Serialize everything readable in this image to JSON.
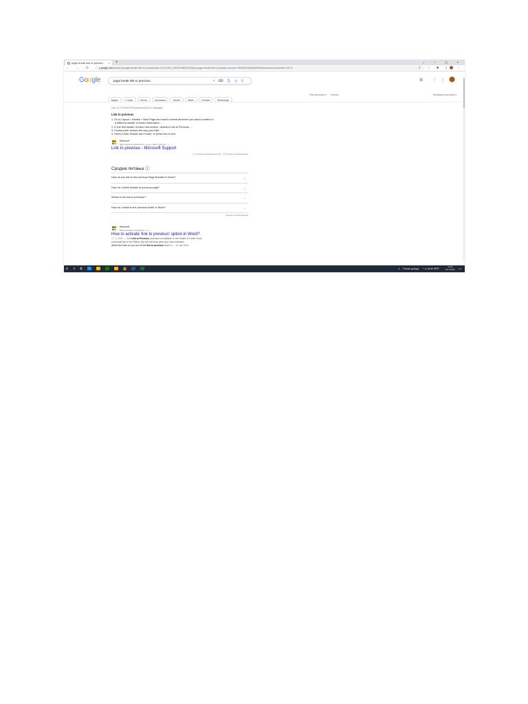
{
  "browser": {
    "tab_title": "page break link to previous - Go",
    "tab_close": "×",
    "new_tab": "+",
    "window_controls": "⌄ – ▢ ×",
    "nav_buttons": "← → ↻ ⌂",
    "url_domain": "google.com",
    "url_rest": "/search?q=page+break+link+to+previous&rlz=1C1CHZO_enRS1018RS1018&oq=page+break+link+to+p&aqs=chrome.1.69i57j0i22i30l2j0i390l3&sourceid=chrome&ie=UTF-8",
    "toolbar_icons": "⇪ ☆ ✱ ▯"
  },
  "google": {
    "logo_letters": [
      "G",
      "o",
      "o",
      "g",
      "l",
      "e"
    ],
    "logo_colors": [
      "#4285f4",
      "#ea4335",
      "#fbbc05",
      "#4285f4",
      "#34a853",
      "#ea4335"
    ],
    "query": "page break link to previous",
    "clear_icon": "×",
    "header_icons": "⚙ ⋮⋮"
  },
  "chips": [
    "Видео",
    "Слике",
    "Вести",
    "Куповина",
    "Књиге",
    "Мапе",
    "Летови",
    "Финансије"
  ],
  "tools": [
    "Сви филтери ▾",
    "Алатке"
  ],
  "safesearch": "Безбедна претрага ▾",
  "results": {
    "stats": "Око 13.170.000.000 резултата (0,51 секунди)",
    "snippet_title": "Link to previous",
    "snippet_steps": [
      "1. Go to Layout > Breaks > Next Page and insert a break wherever you want to switch to",
      "   a different header or footer information. ...",
      "2. In the first header of each new section, deselect Link to Previous. ...",
      "3. Format each section the way you'd like. ...",
      "4. Select Close Header and Footer, or press Esc to exit."
    ],
    "r1_site": "Microsoft",
    "r1_url": "https://support.microsoft.com › en-us › office › link-to-p...   ⋮",
    "r1_title": "Link to previous - Microsoft Support",
    "r1_feedback": "ⓘ О истакнутим фрагментима  ·  ▣ Повратне информације",
    "paa_title": "Сродна питања  ⓘ",
    "questions": [
      "How do you link to the previous Page Number in Word?",
      "How do I unlink header to previous page?",
      "Where is the link to previous?",
      "How do I unlink to the previous footer in Word?"
    ],
    "question_chevron": "⌄",
    "paa_feedback": "Повратне информације",
    "r2_site": "Microsoft",
    "r2_url": "https://answers.microsoft.com › en   ⋮",
    "r2_title": "How to activate 'link to previous' option in Word?",
    "r2_date": "17. 4. 2020.",
    "r2_snip1": " — The ",
    "r2_snip_bold1": "Link to Previous",
    "r2_snip2": " command is available on the Header & Footer Tools",
    "r2_snip3": "contextual tab on the Ribbon (the tab will show when you have activated ...",
    "r2_snip4": "Where the heck do you turn off the ",
    "r2_snip_bold2": "link to previous",
    "r2_snip5": " footer in ...    14. окт 2016."
  },
  "taskbar": {
    "start": "⊞",
    "search": "⚲",
    "taskview": "⧉",
    "apps_colors": [
      "#1e90ff",
      "#f2c200",
      "#0f7b0f",
      "#ffb900",
      "#2b579a",
      "#185abd",
      "#1d6f42"
    ],
    "weather": "Тежак дождь",
    "tray": "^ ▭ ⇆ 🕪 SRP",
    "time": "10:41",
    "date": "26.4.2023."
  }
}
